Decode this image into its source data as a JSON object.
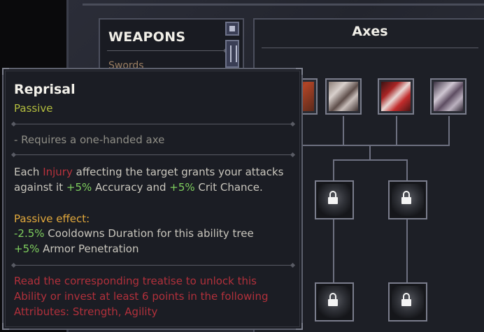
{
  "weapons_panel": {
    "title": "WEAPONS",
    "first_item": "Swords"
  },
  "skill_tree": {
    "title": "Axes",
    "top_row": [
      "ability-4",
      "ability-1",
      "ability-2",
      "ability-3"
    ],
    "locked_slots": 4
  },
  "tooltip": {
    "name": "Reprisal",
    "type": "Passive",
    "requirement": "- Requires a one-handed axe",
    "desc_l1_a": "Each ",
    "desc_l1_b": "Injury",
    "desc_l1_c": " affecting the target grants your attacks",
    "desc_l2_a": "against it ",
    "desc_l2_b": "+5%",
    "desc_l2_c": " Accuracy and ",
    "desc_l2_d": "+5%",
    "desc_l2_e": " Crit Chance.",
    "passive_header": "Passive effect:",
    "effect1_val": "-2.5%",
    "effect1_text": " Cooldowns Duration for this ability tree",
    "effect2_val": "+5%",
    "effect2_text": " Armor Penetration",
    "unlock_l1": "Read the corresponding treatise to unlock this",
    "unlock_l2": "Ability or invest at least 6 points in the following",
    "unlock_l3": "Attributes: Strength, Agility"
  },
  "colors": {
    "passive": "#b3bd3e",
    "injury": "#b8323c",
    "positive": "#7fcf5e",
    "header": "#e3a93c",
    "locked_text": "#b1303b"
  }
}
